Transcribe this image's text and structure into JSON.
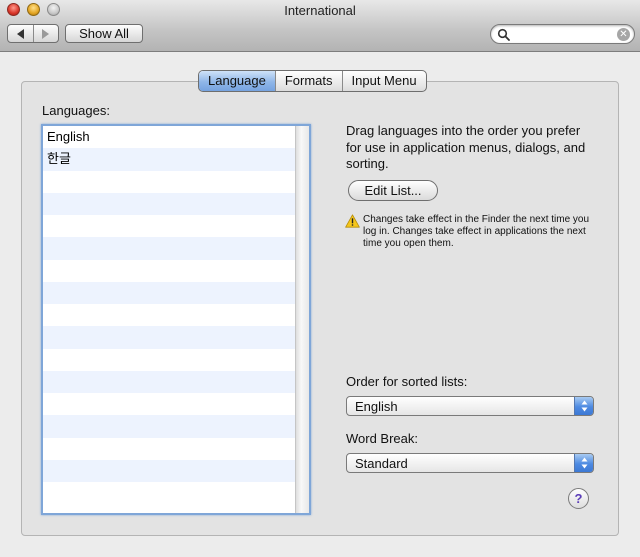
{
  "window": {
    "title": "International"
  },
  "toolbar": {
    "show_all_label": "Show All",
    "search": {
      "value": "",
      "placeholder": ""
    }
  },
  "tabs": [
    {
      "label": "Language",
      "selected": true
    },
    {
      "label": "Formats",
      "selected": false
    },
    {
      "label": "Input Menu",
      "selected": false
    }
  ],
  "languages": {
    "label": "Languages:",
    "items": [
      "English",
      "한글"
    ]
  },
  "description": "Drag languages into the order you prefer for use in application menus, dialogs, and sorting.",
  "edit_list_label": "Edit List...",
  "warning": "Changes take effect in the Finder the next time you log in. Changes take effect in applications the next time you open them.",
  "sorted_lists": {
    "label": "Order for sorted lists:",
    "value": "English"
  },
  "word_break": {
    "label": "Word Break:",
    "value": "Standard"
  },
  "help_label": "?",
  "colors": {
    "selected_tab": "#8fb6e8",
    "list_stripe": "#edf3fe",
    "focus_ring": "#7fa6d8",
    "popup_arrow": "#4d8ae2"
  }
}
